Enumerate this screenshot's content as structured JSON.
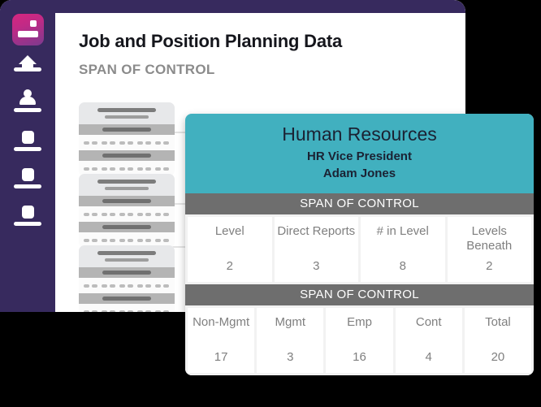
{
  "window": {
    "title": "Job and Position Planning Data",
    "subtitle": "SPAN OF CONTROL"
  },
  "sidebar": {
    "logo": "app-logo",
    "items": [
      {
        "icon": "home-icon"
      },
      {
        "icon": "person-icon"
      },
      {
        "icon": "square-icon"
      },
      {
        "icon": "square-icon"
      },
      {
        "icon": "square-icon"
      }
    ]
  },
  "org_chart": {
    "nodes": [
      {
        "id": "node-1"
      },
      {
        "id": "node-2"
      },
      {
        "id": "node-3"
      }
    ]
  },
  "hr_card": {
    "org": "Human Resources",
    "role": "HR Vice President",
    "name": "Adam Jones",
    "band_label_1": "SPAN OF CONTROL",
    "band_label_2": "SPAN OF CONTROL",
    "metrics_primary": [
      {
        "label": "Level",
        "value": "2"
      },
      {
        "label": "Direct Reports",
        "value": "3"
      },
      {
        "label": "# in Level",
        "value": "8"
      },
      {
        "label": "Levels Beneath",
        "value": "2"
      }
    ],
    "metrics_secondary": [
      {
        "label": "Non-Mgmt",
        "value": "17"
      },
      {
        "label": "Mgmt",
        "value": "3"
      },
      {
        "label": "Emp",
        "value": "16"
      },
      {
        "label": "Cont",
        "value": "4"
      },
      {
        "label": "Total",
        "value": "20"
      }
    ]
  },
  "colors": {
    "sidebar": "#372a5e",
    "teal": "#41b0bf",
    "gray_band": "#6e6e6e",
    "accent_pink": "#d6267f",
    "text_gray": "#7f7f7f"
  }
}
